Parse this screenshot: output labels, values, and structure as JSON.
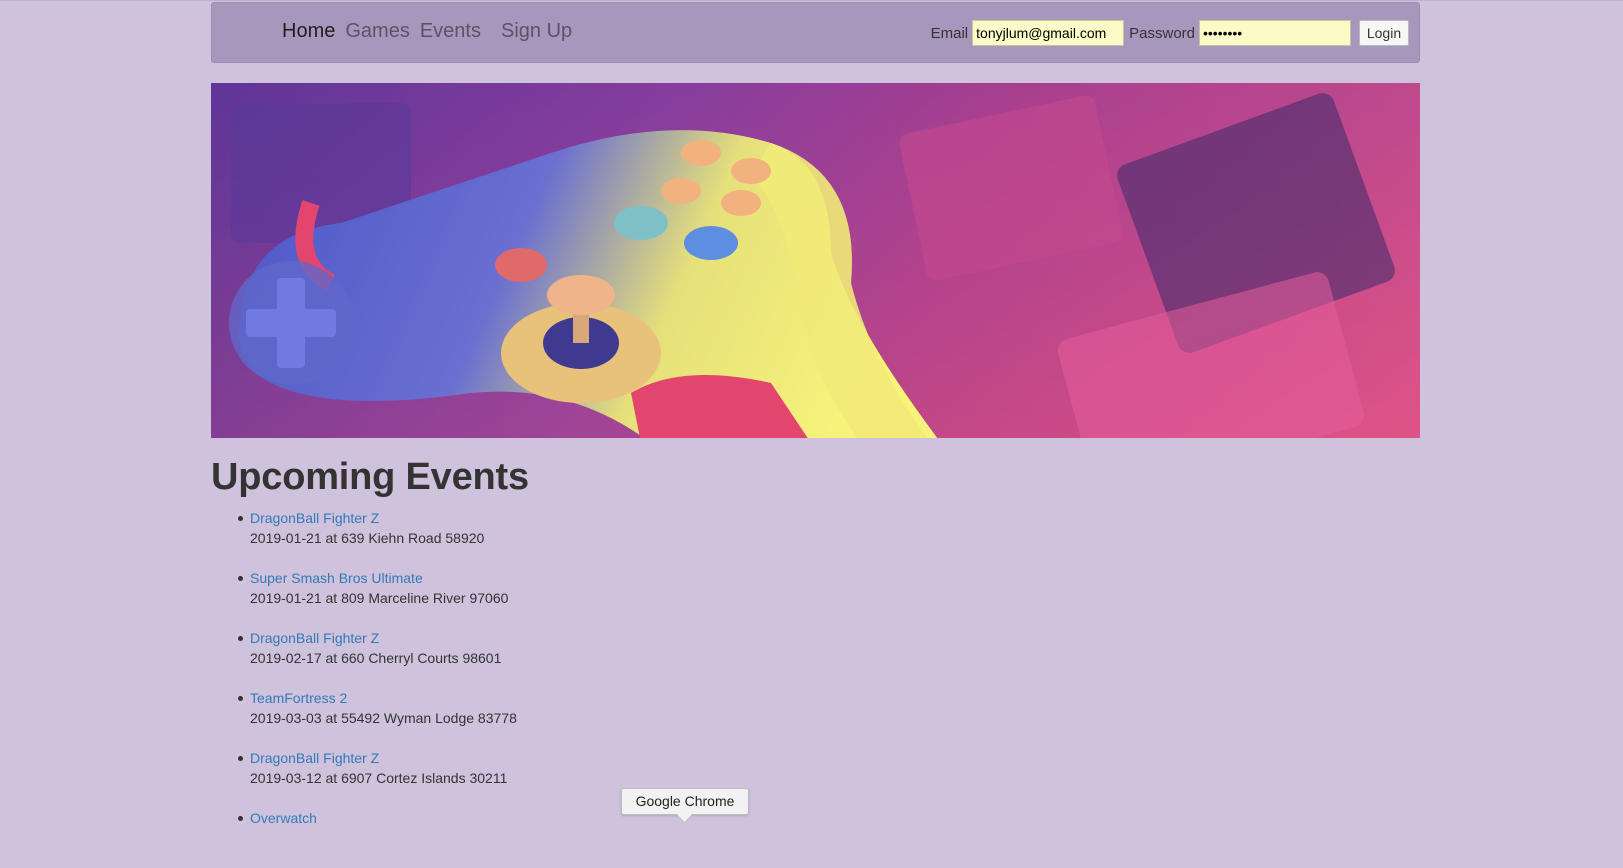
{
  "nav": {
    "links": [
      {
        "label": "Home",
        "active": true
      },
      {
        "label": "Games",
        "active": false
      },
      {
        "label": "Events",
        "active": false
      },
      {
        "label": "Sign Up",
        "active": false
      }
    ]
  },
  "login": {
    "email_label": "Email",
    "email_value": "tonyjlum@gmail.com",
    "password_label": "Password",
    "password_value": "••••••••",
    "button_label": "Login"
  },
  "hero": {
    "image": "retro-game-controller-banner"
  },
  "events_section": {
    "title": "Upcoming Events",
    "items": [
      {
        "name": "DragonBall Fighter Z",
        "detail": "2019-01-21 at 639 Kiehn Road 58920"
      },
      {
        "name": "Super Smash Bros Ultimate",
        "detail": "2019-01-21 at 809 Marceline River 97060"
      },
      {
        "name": "DragonBall Fighter Z",
        "detail": "2019-02-17 at 660 Cherryl Courts 98601"
      },
      {
        "name": "TeamFortress 2",
        "detail": "2019-03-03 at 55492 Wyman Lodge 83778"
      },
      {
        "name": "DragonBall Fighter Z",
        "detail": "2019-03-12 at 6907 Cortez Islands 30211"
      },
      {
        "name": "Overwatch",
        "detail": ""
      }
    ]
  },
  "tooltip": {
    "text": "Google Chrome"
  }
}
